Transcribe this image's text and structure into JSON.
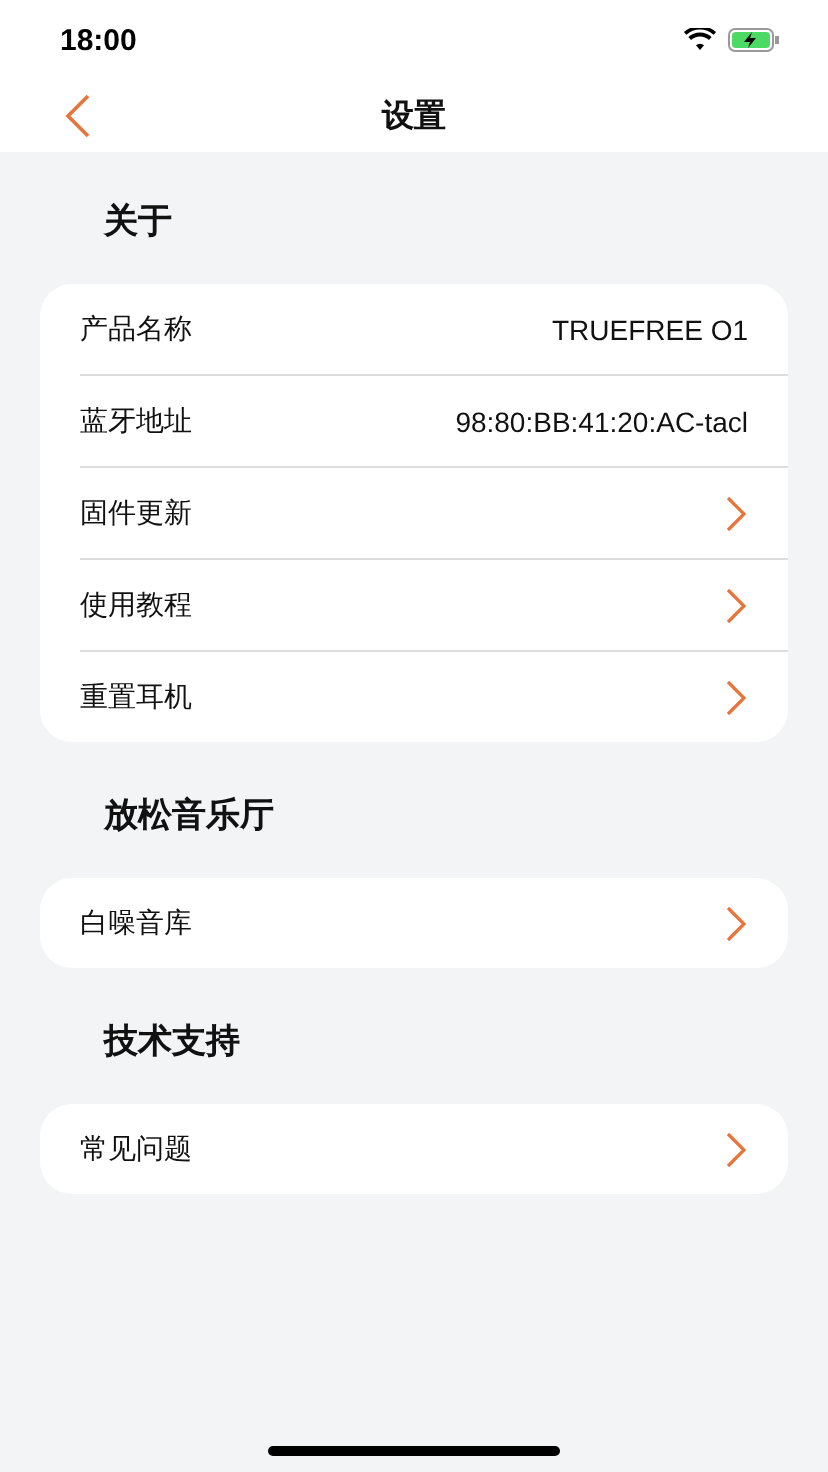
{
  "status_bar": {
    "time": "18:00"
  },
  "header": {
    "title": "设置"
  },
  "sections": [
    {
      "title": "关于",
      "rows": [
        {
          "kind": "value",
          "label": "产品名称",
          "value": "TRUEFREE O1"
        },
        {
          "kind": "value",
          "label": "蓝牙地址",
          "value": "98:80:BB:41:20:AC-tacl"
        },
        {
          "kind": "link",
          "label": "固件更新"
        },
        {
          "kind": "link",
          "label": "使用教程"
        },
        {
          "kind": "link",
          "label": "重置耳机"
        }
      ]
    },
    {
      "title": "放松音乐厅",
      "rows": [
        {
          "kind": "link",
          "label": "白噪音库"
        }
      ]
    },
    {
      "title": "技术支持",
      "rows": [
        {
          "kind": "link",
          "label": "常见问题"
        }
      ]
    }
  ]
}
